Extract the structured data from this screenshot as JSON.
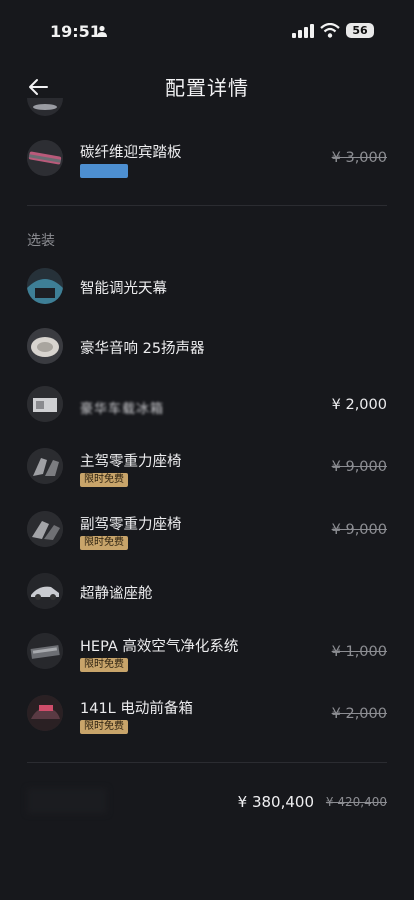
{
  "status": {
    "time": "19:51",
    "battery": "56"
  },
  "header": {
    "title": "配置详情"
  },
  "carbon_item": {
    "name": "碳纤维迎宾踏板",
    "price": "¥ 3,000"
  },
  "section": {
    "label": "选装"
  },
  "options": [
    {
      "name": "智能调光天幕"
    },
    {
      "name": "豪华音响 25扬声器"
    },
    {
      "name": "豪华车载冰箱",
      "price": "¥ 2,000"
    },
    {
      "name": "主驾零重力座椅",
      "badge": "限时免费",
      "price": "¥ 9,000"
    },
    {
      "name": "副驾零重力座椅",
      "badge": "限时免费",
      "price": "¥ 9,000"
    },
    {
      "name": "超静谧座舱"
    },
    {
      "name": "HEPA 高效空气净化系统",
      "badge": "限时免费",
      "price": "¥ 1,000"
    },
    {
      "name": "141L 电动前备箱",
      "badge": "限时免费",
      "price": "¥ 2,000"
    }
  ],
  "total": {
    "price": "¥ 380,400",
    "original": "¥ 420,400"
  },
  "colors": {
    "background": "#17181c",
    "badge": "#c8a46a",
    "swatch": "#4d8fd1"
  }
}
